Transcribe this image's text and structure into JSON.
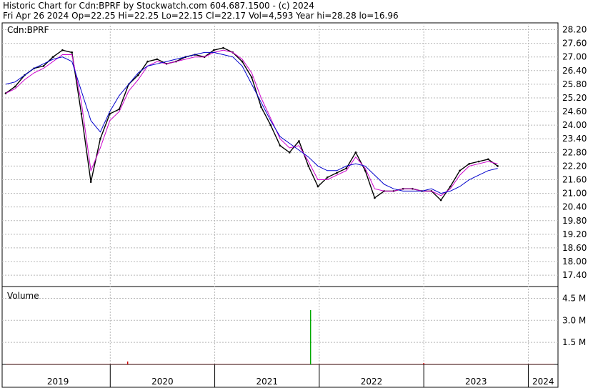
{
  "header": {
    "line1": "Historic Chart for Cdn:BPRF by Stockwatch.com 604.687.1500 - (c) 2024",
    "line2": "Fri Apr 26 2024  Op=22.25  Hi=22.25  Lo=22.15  Cl=22.17  Vol=4,593  Year hi=28.28  lo=16.96"
  },
  "chart_data": [
    {
      "type": "line",
      "title": "Cdn:BPRF",
      "x": [
        "2019-01",
        "2019-03",
        "2019-05",
        "2019-07",
        "2019-09",
        "2019-11",
        "2019-12",
        "2020-01",
        "2020-02",
        "2020-03",
        "2020-04",
        "2020-05",
        "2020-06",
        "2020-07",
        "2020-08",
        "2020-09",
        "2020-10",
        "2020-11",
        "2020-12",
        "2021-01",
        "2021-02",
        "2021-03",
        "2021-04",
        "2021-05",
        "2021-06",
        "2021-07",
        "2021-08",
        "2021-09",
        "2021-10",
        "2021-11",
        "2021-12",
        "2022-01",
        "2022-02",
        "2022-03",
        "2022-04",
        "2022-05",
        "2022-06",
        "2022-07",
        "2022-08",
        "2022-09",
        "2022-10",
        "2022-11",
        "2022-12",
        "2023-01",
        "2023-02",
        "2023-03",
        "2023-04",
        "2023-05",
        "2023-06",
        "2023-07",
        "2023-08",
        "2023-09",
        "2023-10",
        "2023-11",
        "2023-12",
        "2024-01",
        "2024-02",
        "2024-03",
        "2024-04"
      ],
      "series": [
        {
          "values": [
            25.4,
            25.7,
            26.2,
            26.5,
            26.6,
            27.0,
            27.3,
            27.2,
            24.5,
            21.5,
            23.4,
            24.5,
            24.7,
            25.8,
            26.2,
            26.8,
            26.9,
            26.7,
            26.8,
            27.0,
            27.1,
            27.0,
            27.3,
            27.4,
            27.2,
            26.8,
            26.1,
            24.8,
            24.0,
            23.1,
            22.8,
            23.3,
            22.2,
            21.3,
            21.7,
            21.9,
            22.1,
            22.8,
            22.0,
            20.8,
            21.1,
            21.1,
            21.2,
            21.2,
            21.1,
            21.1,
            20.7,
            21.3,
            22.0,
            22.3,
            22.4,
            22.5,
            22.2
          ]
        },
        {
          "color": "#cc00cc",
          "values": [
            25.4,
            25.6,
            26.0,
            26.3,
            26.5,
            26.8,
            27.1,
            27.1,
            25.0,
            22.0,
            23.0,
            24.2,
            24.6,
            25.5,
            26.0,
            26.6,
            26.8,
            26.7,
            26.8,
            26.9,
            27.0,
            27.0,
            27.2,
            27.3,
            27.2,
            26.9,
            26.3,
            25.2,
            24.3,
            23.4,
            23.0,
            23.1,
            22.4,
            21.6,
            21.6,
            21.8,
            22.0,
            22.6,
            22.1,
            21.2,
            21.1,
            21.1,
            21.2,
            21.2,
            21.1,
            21.1,
            20.9,
            21.2,
            21.8,
            22.2,
            22.3,
            22.4,
            22.3
          ]
        },
        {
          "color": "#0000cc",
          "values": [
            25.8,
            25.9,
            26.2,
            26.5,
            26.7,
            26.9,
            27.0,
            26.8,
            25.5,
            24.2,
            23.7,
            24.6,
            25.3,
            25.8,
            26.3,
            26.6,
            26.7,
            26.8,
            26.9,
            27.0,
            27.1,
            27.2,
            27.2,
            27.1,
            27.0,
            26.6,
            25.8,
            25.0,
            24.2,
            23.5,
            23.2,
            22.9,
            22.6,
            22.2,
            22.0,
            22.0,
            22.2,
            22.3,
            22.2,
            21.8,
            21.4,
            21.2,
            21.1,
            21.1,
            21.1,
            21.2,
            21.0,
            21.1,
            21.3,
            21.6,
            21.8,
            22.0,
            22.1
          ]
        }
      ],
      "ylim": [
        16.9,
        28.5
      ],
      "yticks": [
        "28.20",
        "27.60",
        "27.00",
        "26.40",
        "25.80",
        "25.20",
        "24.60",
        "24.00",
        "23.40",
        "22.80",
        "22.20",
        "21.60",
        "21.00",
        "20.40",
        "19.80",
        "19.20",
        "18.60",
        "18.00",
        "17.40"
      ],
      "xtick_labels": [
        "2019",
        "2020",
        "2021",
        "2022",
        "2023",
        "2024"
      ],
      "grid": true
    },
    {
      "type": "bar",
      "title": "Volume",
      "spikes": [
        {
          "date": "2020-03",
          "value": 0.2,
          "color": "#cc0000"
        },
        {
          "date": "2021-12",
          "value": 3.7,
          "color": "#00aa00"
        },
        {
          "date": "2023-01",
          "value": 0.1,
          "color": "#cc0000"
        }
      ],
      "baseline_value": 0.04,
      "ylim": [
        0,
        5.3
      ],
      "yticks": [
        "4.5 M",
        "3.0 M",
        "1.5 M"
      ],
      "grid": true
    }
  ]
}
